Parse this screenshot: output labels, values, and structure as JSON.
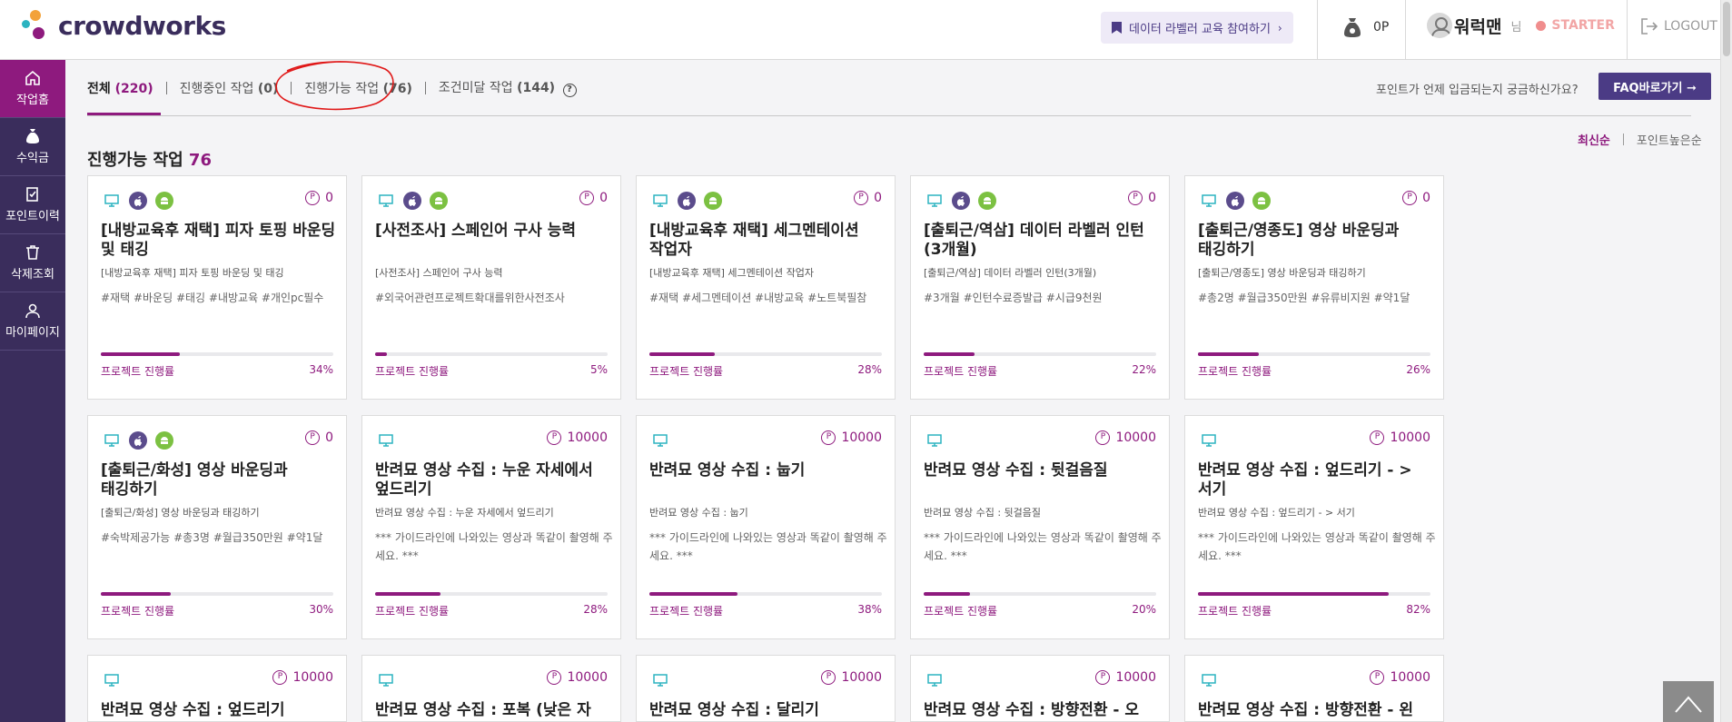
{
  "header": {
    "brand": "crowdworks",
    "edu_button": "데이터 라벨러 교육 참여하기",
    "points": "0P",
    "user_name": "워럭맨",
    "user_suffix": "님",
    "grade": "STARTER",
    "logout": "LOGOUT"
  },
  "sidebar": {
    "items": [
      {
        "label": "작업홈",
        "icon": "home-icon"
      },
      {
        "label": "수익금",
        "icon": "money-bag-icon"
      },
      {
        "label": "포인트이력",
        "icon": "clipboard-check-icon"
      },
      {
        "label": "삭제조회",
        "icon": "trash-icon"
      },
      {
        "label": "마이페이지",
        "icon": "user-icon"
      }
    ]
  },
  "tabs": [
    {
      "label": "전체",
      "count": "(220)"
    },
    {
      "label": "진행중인 작업",
      "count": "(0)"
    },
    {
      "label": "진행가능 작업",
      "count": "(76)"
    },
    {
      "label": "조건미달 작업",
      "count": "(144)"
    }
  ],
  "faq": {
    "question": "포인트가 언제 입금되는지 궁금하신가요?",
    "button": "FAQ바로가기 ➞"
  },
  "sort": {
    "latest": "최신순",
    "points_high": "포인트높은순"
  },
  "section": {
    "title": "진행가능 작업",
    "count": "76"
  },
  "progress_label": "프로젝트 진행률",
  "cards": [
    {
      "title": "[내방교육후 재택] 피자 토핑 바운딩 및 태깅",
      "subtitle": "[내방교육후 재택] 피자 토핑 바운딩 및 태깅",
      "tags": "#재택 #바운딩 #태깅 #내방교육 #개인pc필수",
      "points": "0",
      "platforms": [
        "pc",
        "ios",
        "android"
      ],
      "progress": 34,
      "progress_text": "34%"
    },
    {
      "title": "[사전조사] 스페인어 구사 능력",
      "subtitle": "[사전조사] 스페인어 구사 능력",
      "tags": "#외국어관련프로젝트확대를위한사전조사",
      "points": "0",
      "platforms": [
        "pc",
        "ios",
        "android"
      ],
      "progress": 5,
      "progress_text": "5%"
    },
    {
      "title": "[내방교육후 재택] 세그멘테이션 작업자",
      "subtitle": "[내방교육후 재택] 세그멘테이션 작업자",
      "tags": "#재택 #세그멘테이션 #내방교육 #노트북필참",
      "points": "0",
      "platforms": [
        "pc",
        "ios",
        "android"
      ],
      "progress": 28,
      "progress_text": "28%"
    },
    {
      "title": "[출퇴근/역삼] 데이터 라벨러 인턴(3개월)",
      "subtitle": "[출퇴근/역삼] 데이터 라벨러 인턴(3개월)",
      "tags": "#3개월 #인턴수료증발급 #시급9천원",
      "points": "0",
      "platforms": [
        "pc",
        "ios",
        "android"
      ],
      "progress": 22,
      "progress_text": "22%"
    },
    {
      "title": "[출퇴근/영종도] 영상 바운딩과 태깅하기",
      "subtitle": "[출퇴근/영종도] 영상 바운딩과 태깅하기",
      "tags": "#총2명 #월급350만원 #유류비지원 #약1달",
      "points": "0",
      "platforms": [
        "pc",
        "ios",
        "android"
      ],
      "progress": 26,
      "progress_text": "26%"
    },
    {
      "title": "[출퇴근/화성] 영상 바운딩과 태깅하기",
      "subtitle": "[출퇴근/화성] 영상 바운딩과 태깅하기",
      "tags": "#숙박제공가능 #총3명 #월급350만원 #약1달",
      "points": "0",
      "platforms": [
        "pc",
        "ios",
        "android"
      ],
      "progress": 30,
      "progress_text": "30%"
    },
    {
      "title": "반려묘 영상 수집 : 누운 자세에서 엎드리기",
      "subtitle": "반려묘 영상 수집 : 누운 자세에서 엎드리기",
      "tags": "*** 가이드라인에 나와있는 영상과 똑같이 촬영해 주세요. ***",
      "points": "10000",
      "platforms": [
        "pc"
      ],
      "progress": 28,
      "progress_text": "28%"
    },
    {
      "title": "반려묘 영상 수집 : 눕기",
      "subtitle": "반려묘 영상 수집 : 눕기",
      "tags": "*** 가이드라인에 나와있는 영상과 똑같이 촬영해 주세요. ***",
      "points": "10000",
      "platforms": [
        "pc"
      ],
      "progress": 38,
      "progress_text": "38%"
    },
    {
      "title": "반려묘 영상 수집 : 뒷걸음질",
      "subtitle": "반려묘 영상 수집 : 뒷걸음질",
      "tags": "*** 가이드라인에 나와있는 영상과 똑같이 촬영해 주세요. ***",
      "points": "10000",
      "platforms": [
        "pc"
      ],
      "progress": 20,
      "progress_text": "20%"
    },
    {
      "title": "반려묘 영상 수집 : 엎드리기 - > 서기",
      "subtitle": "반려묘 영상 수집 : 엎드리기 - > 서기",
      "tags": "*** 가이드라인에 나와있는 영상과 똑같이 촬영해 주세요. ***",
      "points": "10000",
      "platforms": [
        "pc"
      ],
      "progress": 82,
      "progress_text": "82%"
    },
    {
      "title": "반려묘 영상 수집 : 엎드리기",
      "points": "10000",
      "platforms": [
        "pc"
      ]
    },
    {
      "title": "반려묘 영상 수집 : 포복 (낮은 자",
      "points": "10000",
      "platforms": [
        "pc"
      ]
    },
    {
      "title": "반려묘 영상 수집 : 달리기",
      "points": "10000",
      "platforms": [
        "pc"
      ]
    },
    {
      "title": "반려묘 영상 수집 : 방향전환 - 오",
      "points": "10000",
      "platforms": [
        "pc"
      ]
    },
    {
      "title": "반려묘 영상 수집 : 방향전환 - 왼",
      "points": "10000",
      "platforms": [
        "pc"
      ]
    }
  ],
  "colors": {
    "brand_purple": "#3a2d5c",
    "accent_magenta": "#8e1a7e",
    "faq_button": "#4b3b85"
  }
}
